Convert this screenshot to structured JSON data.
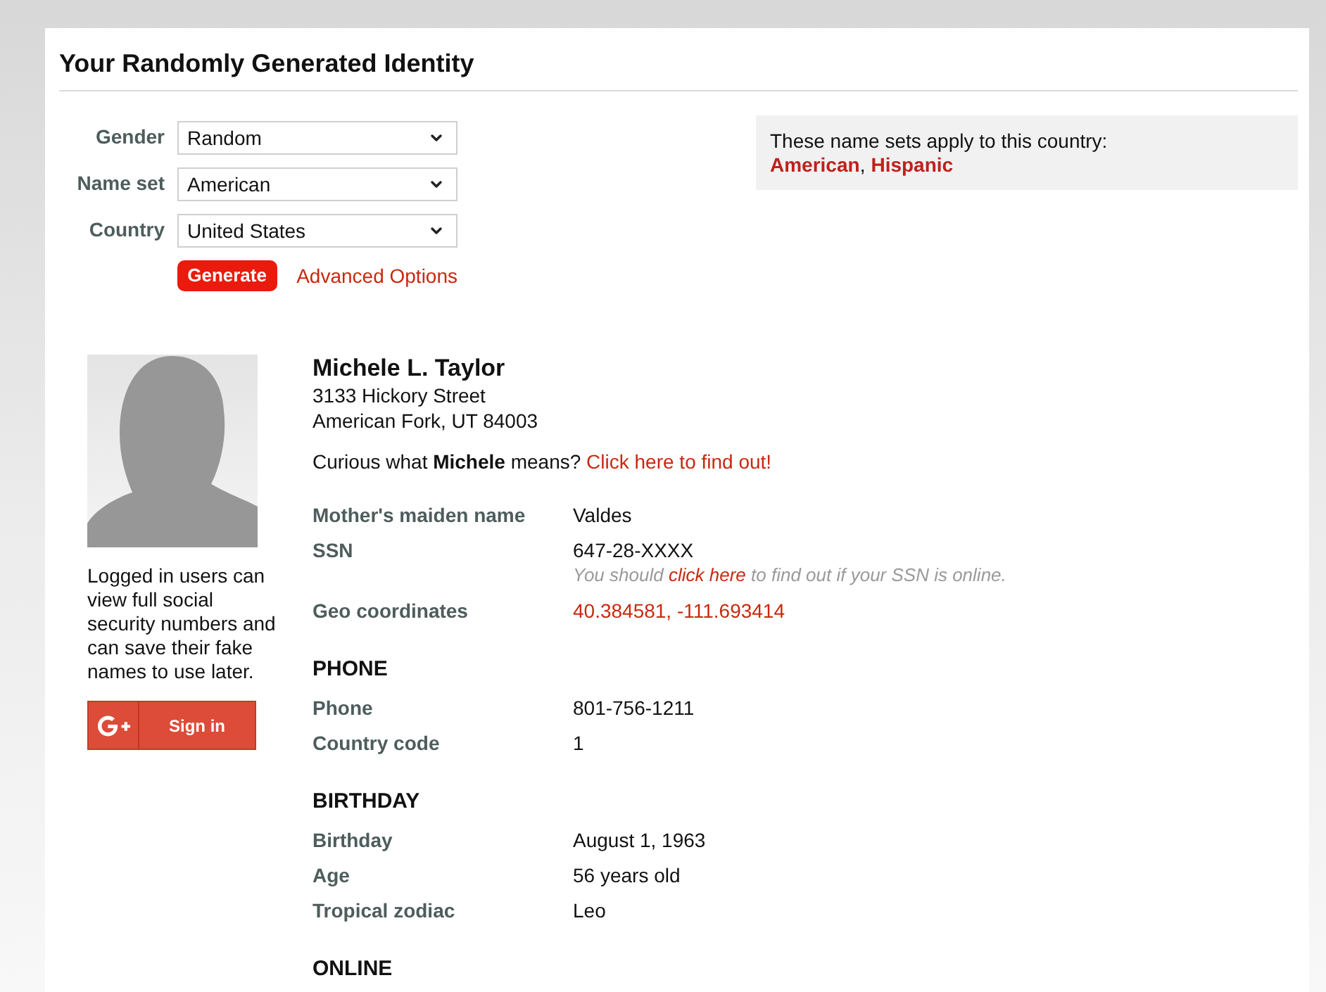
{
  "page": {
    "title": "Your Randomly Generated Identity"
  },
  "form": {
    "fields": [
      {
        "label": "Gender",
        "value": "Random"
      },
      {
        "label": "Name set",
        "value": "American"
      },
      {
        "label": "Country",
        "value": "United States"
      }
    ],
    "generate_button": "Generate",
    "advanced_link": "Advanced Options"
  },
  "name_sets_box": {
    "text": "These name sets apply to this country:",
    "links": [
      "American",
      "Hispanic"
    ],
    "separator": ","
  },
  "sidebar": {
    "login_note": "Logged in users can view full social security numbers and can save their fake names to use later.",
    "signin_button": "Sign in"
  },
  "identity": {
    "name": "Michele L. Taylor",
    "address": [
      "3133 Hickory Street",
      "American Fork, UT 84003"
    ],
    "meaning": {
      "text": "Curious what **Michele** means?",
      "link": "Click here to find out!"
    }
  },
  "details": [
    {
      "label": "Mother's maiden name",
      "value": "Valdes",
      "kind": "text"
    },
    {
      "label": "SSN",
      "value": "647-28-XXXX",
      "kind": "text",
      "note": {
        "before": "You should",
        "link": "click here",
        "after": "to find out if your SSN is online."
      }
    },
    {
      "label": "Geo coordinates",
      "value": "40.384581, -111.693414",
      "kind": "link"
    }
  ],
  "sections": [
    {
      "heading": "PHONE",
      "rows": [
        {
          "label": "Phone",
          "value": "801-756-1211",
          "kind": "text"
        },
        {
          "label": "Country code",
          "value": "1",
          "kind": "text"
        }
      ]
    },
    {
      "heading": "BIRTHDAY",
      "rows": [
        {
          "label": "Birthday",
          "value": "August 1, 1963",
          "kind": "text"
        },
        {
          "label": "Age",
          "value": "56 years old",
          "kind": "text"
        },
        {
          "label": "Tropical zodiac",
          "value": "Leo",
          "kind": "text"
        }
      ]
    },
    {
      "heading": "ONLINE"
    }
  ]
}
